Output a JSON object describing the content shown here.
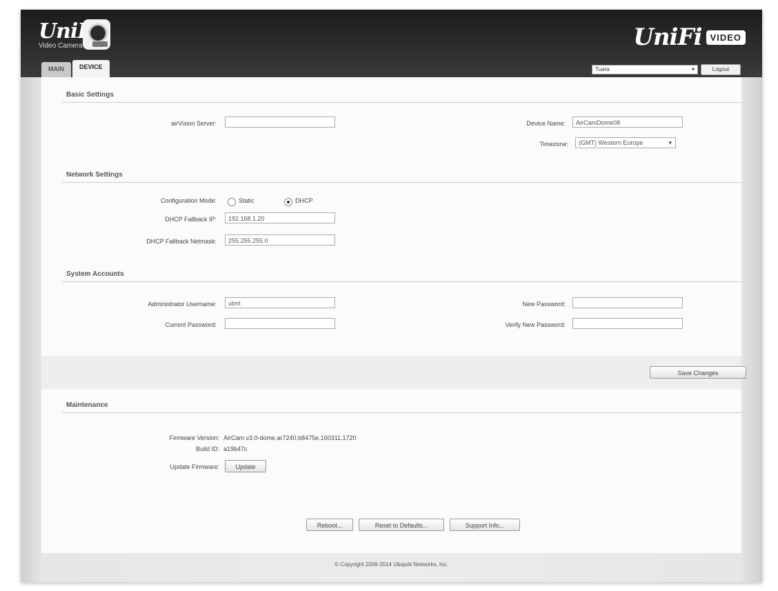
{
  "header": {
    "logo_left_text": "UniFi",
    "logo_left_sub": "Video Camera",
    "logo_right_text": "UniFi",
    "logo_right_badge": "VIDEO",
    "language": "Tuara",
    "logout_label": "Logout"
  },
  "tabs": [
    {
      "label": "MAIN",
      "active": false
    },
    {
      "label": "DEVICE",
      "active": true
    }
  ],
  "basic": {
    "title": "Basic Settings",
    "nvr_label": "airVision Server:",
    "nvr_value": "",
    "device_name_label": "Device Name:",
    "device_name_value": "AirCamDome08",
    "timezone_label": "Timezone:",
    "timezone_value": "(GMT) Western Europe"
  },
  "network": {
    "title": "Network Settings",
    "mode_label": "Configuration Mode:",
    "opt_static": "Static",
    "opt_dhcp": "DHCP",
    "selected": "DHCP",
    "fallback_ip_label": "DHCP Fallback IP:",
    "fallback_ip_value": "192.168.1.20",
    "fallback_mask_label": "DHCP Fallback Netmask:",
    "fallback_mask_value": "255.255.255.0"
  },
  "accounts": {
    "title": "System Accounts",
    "admin_label": "Administrator Username:",
    "admin_value": "ubnt",
    "current_pw_label": "Current Password:",
    "current_pw_value": "",
    "new_pw_label": "New Password:",
    "new_pw_value": "",
    "verify_pw_label": "Verify New Password:",
    "verify_pw_value": ""
  },
  "save_label": "Save Changes",
  "maintenance": {
    "title": "Maintenance",
    "fw_label": "Firmware Version:",
    "fw_value": "AirCam.v3.0-dome.ar7240.b8475e.160311.1720",
    "build_label": "Build ID:",
    "build_value": "a19b47c",
    "update_label": "Update Firmware:",
    "update_btn": "Update"
  },
  "actions": {
    "reboot": "Reboot...",
    "reset": "Reset to Defaults...",
    "support": "Support Info..."
  },
  "footer": "© Copyright 2006-2014 Ubiquiti Networks, Inc."
}
